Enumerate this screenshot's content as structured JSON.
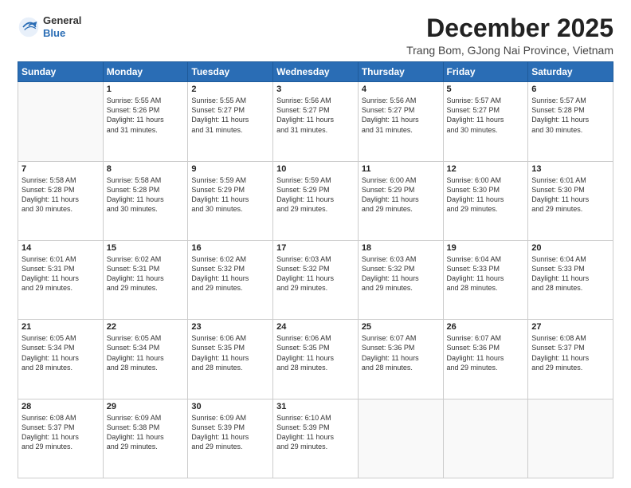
{
  "logo": {
    "general": "General",
    "blue": "Blue"
  },
  "header": {
    "month": "December 2025",
    "location": "Trang Bom, GJong Nai Province, Vietnam"
  },
  "weekdays": [
    "Sunday",
    "Monday",
    "Tuesday",
    "Wednesday",
    "Thursday",
    "Friday",
    "Saturday"
  ],
  "weeks": [
    [
      {
        "day": "",
        "info": ""
      },
      {
        "day": "1",
        "info": "Sunrise: 5:55 AM\nSunset: 5:26 PM\nDaylight: 11 hours\nand 31 minutes."
      },
      {
        "day": "2",
        "info": "Sunrise: 5:55 AM\nSunset: 5:27 PM\nDaylight: 11 hours\nand 31 minutes."
      },
      {
        "day": "3",
        "info": "Sunrise: 5:56 AM\nSunset: 5:27 PM\nDaylight: 11 hours\nand 31 minutes."
      },
      {
        "day": "4",
        "info": "Sunrise: 5:56 AM\nSunset: 5:27 PM\nDaylight: 11 hours\nand 31 minutes."
      },
      {
        "day": "5",
        "info": "Sunrise: 5:57 AM\nSunset: 5:27 PM\nDaylight: 11 hours\nand 30 minutes."
      },
      {
        "day": "6",
        "info": "Sunrise: 5:57 AM\nSunset: 5:28 PM\nDaylight: 11 hours\nand 30 minutes."
      }
    ],
    [
      {
        "day": "7",
        "info": "Sunrise: 5:58 AM\nSunset: 5:28 PM\nDaylight: 11 hours\nand 30 minutes."
      },
      {
        "day": "8",
        "info": "Sunrise: 5:58 AM\nSunset: 5:28 PM\nDaylight: 11 hours\nand 30 minutes."
      },
      {
        "day": "9",
        "info": "Sunrise: 5:59 AM\nSunset: 5:29 PM\nDaylight: 11 hours\nand 30 minutes."
      },
      {
        "day": "10",
        "info": "Sunrise: 5:59 AM\nSunset: 5:29 PM\nDaylight: 11 hours\nand 29 minutes."
      },
      {
        "day": "11",
        "info": "Sunrise: 6:00 AM\nSunset: 5:29 PM\nDaylight: 11 hours\nand 29 minutes."
      },
      {
        "day": "12",
        "info": "Sunrise: 6:00 AM\nSunset: 5:30 PM\nDaylight: 11 hours\nand 29 minutes."
      },
      {
        "day": "13",
        "info": "Sunrise: 6:01 AM\nSunset: 5:30 PM\nDaylight: 11 hours\nand 29 minutes."
      }
    ],
    [
      {
        "day": "14",
        "info": "Sunrise: 6:01 AM\nSunset: 5:31 PM\nDaylight: 11 hours\nand 29 minutes."
      },
      {
        "day": "15",
        "info": "Sunrise: 6:02 AM\nSunset: 5:31 PM\nDaylight: 11 hours\nand 29 minutes."
      },
      {
        "day": "16",
        "info": "Sunrise: 6:02 AM\nSunset: 5:32 PM\nDaylight: 11 hours\nand 29 minutes."
      },
      {
        "day": "17",
        "info": "Sunrise: 6:03 AM\nSunset: 5:32 PM\nDaylight: 11 hours\nand 29 minutes."
      },
      {
        "day": "18",
        "info": "Sunrise: 6:03 AM\nSunset: 5:32 PM\nDaylight: 11 hours\nand 29 minutes."
      },
      {
        "day": "19",
        "info": "Sunrise: 6:04 AM\nSunset: 5:33 PM\nDaylight: 11 hours\nand 28 minutes."
      },
      {
        "day": "20",
        "info": "Sunrise: 6:04 AM\nSunset: 5:33 PM\nDaylight: 11 hours\nand 28 minutes."
      }
    ],
    [
      {
        "day": "21",
        "info": "Sunrise: 6:05 AM\nSunset: 5:34 PM\nDaylight: 11 hours\nand 28 minutes."
      },
      {
        "day": "22",
        "info": "Sunrise: 6:05 AM\nSunset: 5:34 PM\nDaylight: 11 hours\nand 28 minutes."
      },
      {
        "day": "23",
        "info": "Sunrise: 6:06 AM\nSunset: 5:35 PM\nDaylight: 11 hours\nand 28 minutes."
      },
      {
        "day": "24",
        "info": "Sunrise: 6:06 AM\nSunset: 5:35 PM\nDaylight: 11 hours\nand 28 minutes."
      },
      {
        "day": "25",
        "info": "Sunrise: 6:07 AM\nSunset: 5:36 PM\nDaylight: 11 hours\nand 28 minutes."
      },
      {
        "day": "26",
        "info": "Sunrise: 6:07 AM\nSunset: 5:36 PM\nDaylight: 11 hours\nand 29 minutes."
      },
      {
        "day": "27",
        "info": "Sunrise: 6:08 AM\nSunset: 5:37 PM\nDaylight: 11 hours\nand 29 minutes."
      }
    ],
    [
      {
        "day": "28",
        "info": "Sunrise: 6:08 AM\nSunset: 5:37 PM\nDaylight: 11 hours\nand 29 minutes."
      },
      {
        "day": "29",
        "info": "Sunrise: 6:09 AM\nSunset: 5:38 PM\nDaylight: 11 hours\nand 29 minutes."
      },
      {
        "day": "30",
        "info": "Sunrise: 6:09 AM\nSunset: 5:39 PM\nDaylight: 11 hours\nand 29 minutes."
      },
      {
        "day": "31",
        "info": "Sunrise: 6:10 AM\nSunset: 5:39 PM\nDaylight: 11 hours\nand 29 minutes."
      },
      {
        "day": "",
        "info": ""
      },
      {
        "day": "",
        "info": ""
      },
      {
        "day": "",
        "info": ""
      }
    ]
  ]
}
